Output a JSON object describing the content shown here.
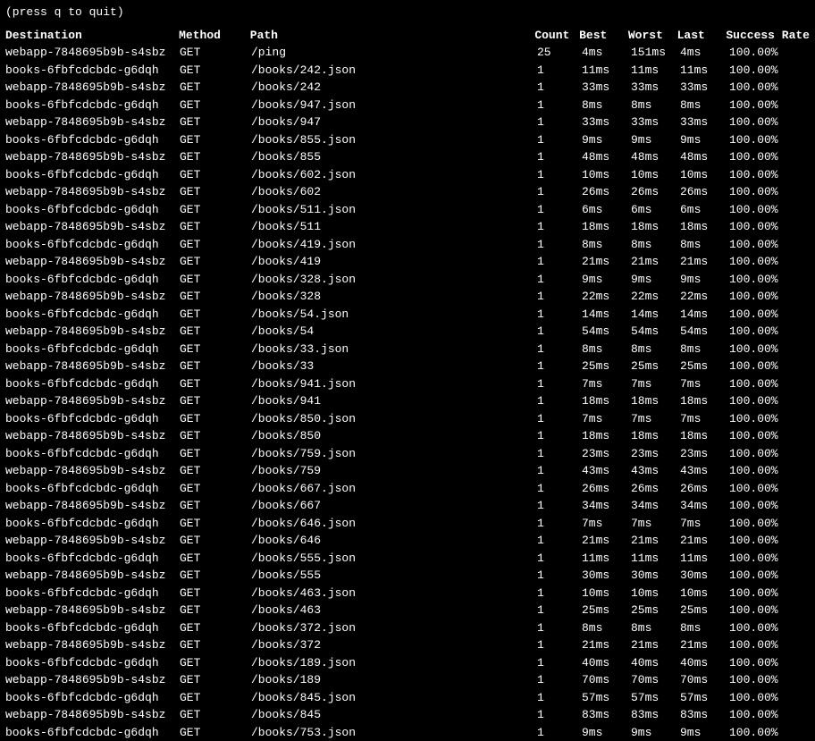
{
  "hint": "(press q to quit)",
  "columns": {
    "destination": "Destination",
    "method": "Method",
    "path": "Path",
    "count": "Count",
    "best": "Best",
    "worst": "Worst",
    "last": "Last",
    "success_rate": "Success Rate"
  },
  "rows": [
    {
      "destination": "webapp-7848695b9b-s4sbz",
      "method": "GET",
      "path": "/ping",
      "count": "25",
      "best": "4ms",
      "worst": "151ms",
      "last": "4ms",
      "success_rate": "100.00%"
    },
    {
      "destination": "books-6fbfcdcbdc-g6dqh",
      "method": "GET",
      "path": "/books/242.json",
      "count": "1",
      "best": "11ms",
      "worst": "11ms",
      "last": "11ms",
      "success_rate": "100.00%"
    },
    {
      "destination": "webapp-7848695b9b-s4sbz",
      "method": "GET",
      "path": "/books/242",
      "count": "1",
      "best": "33ms",
      "worst": "33ms",
      "last": "33ms",
      "success_rate": "100.00%"
    },
    {
      "destination": "books-6fbfcdcbdc-g6dqh",
      "method": "GET",
      "path": "/books/947.json",
      "count": "1",
      "best": "8ms",
      "worst": "8ms",
      "last": "8ms",
      "success_rate": "100.00%"
    },
    {
      "destination": "webapp-7848695b9b-s4sbz",
      "method": "GET",
      "path": "/books/947",
      "count": "1",
      "best": "33ms",
      "worst": "33ms",
      "last": "33ms",
      "success_rate": "100.00%"
    },
    {
      "destination": "books-6fbfcdcbdc-g6dqh",
      "method": "GET",
      "path": "/books/855.json",
      "count": "1",
      "best": "9ms",
      "worst": "9ms",
      "last": "9ms",
      "success_rate": "100.00%"
    },
    {
      "destination": "webapp-7848695b9b-s4sbz",
      "method": "GET",
      "path": "/books/855",
      "count": "1",
      "best": "48ms",
      "worst": "48ms",
      "last": "48ms",
      "success_rate": "100.00%"
    },
    {
      "destination": "books-6fbfcdcbdc-g6dqh",
      "method": "GET",
      "path": "/books/602.json",
      "count": "1",
      "best": "10ms",
      "worst": "10ms",
      "last": "10ms",
      "success_rate": "100.00%"
    },
    {
      "destination": "webapp-7848695b9b-s4sbz",
      "method": "GET",
      "path": "/books/602",
      "count": "1",
      "best": "26ms",
      "worst": "26ms",
      "last": "26ms",
      "success_rate": "100.00%"
    },
    {
      "destination": "books-6fbfcdcbdc-g6dqh",
      "method": "GET",
      "path": "/books/511.json",
      "count": "1",
      "best": "6ms",
      "worst": "6ms",
      "last": "6ms",
      "success_rate": "100.00%"
    },
    {
      "destination": "webapp-7848695b9b-s4sbz",
      "method": "GET",
      "path": "/books/511",
      "count": "1",
      "best": "18ms",
      "worst": "18ms",
      "last": "18ms",
      "success_rate": "100.00%"
    },
    {
      "destination": "books-6fbfcdcbdc-g6dqh",
      "method": "GET",
      "path": "/books/419.json",
      "count": "1",
      "best": "8ms",
      "worst": "8ms",
      "last": "8ms",
      "success_rate": "100.00%"
    },
    {
      "destination": "webapp-7848695b9b-s4sbz",
      "method": "GET",
      "path": "/books/419",
      "count": "1",
      "best": "21ms",
      "worst": "21ms",
      "last": "21ms",
      "success_rate": "100.00%"
    },
    {
      "destination": "books-6fbfcdcbdc-g6dqh",
      "method": "GET",
      "path": "/books/328.json",
      "count": "1",
      "best": "9ms",
      "worst": "9ms",
      "last": "9ms",
      "success_rate": "100.00%"
    },
    {
      "destination": "webapp-7848695b9b-s4sbz",
      "method": "GET",
      "path": "/books/328",
      "count": "1",
      "best": "22ms",
      "worst": "22ms",
      "last": "22ms",
      "success_rate": "100.00%"
    },
    {
      "destination": "books-6fbfcdcbdc-g6dqh",
      "method": "GET",
      "path": "/books/54.json",
      "count": "1",
      "best": "14ms",
      "worst": "14ms",
      "last": "14ms",
      "success_rate": "100.00%"
    },
    {
      "destination": "webapp-7848695b9b-s4sbz",
      "method": "GET",
      "path": "/books/54",
      "count": "1",
      "best": "54ms",
      "worst": "54ms",
      "last": "54ms",
      "success_rate": "100.00%"
    },
    {
      "destination": "books-6fbfcdcbdc-g6dqh",
      "method": "GET",
      "path": "/books/33.json",
      "count": "1",
      "best": "8ms",
      "worst": "8ms",
      "last": "8ms",
      "success_rate": "100.00%"
    },
    {
      "destination": "webapp-7848695b9b-s4sbz",
      "method": "GET",
      "path": "/books/33",
      "count": "1",
      "best": "25ms",
      "worst": "25ms",
      "last": "25ms",
      "success_rate": "100.00%"
    },
    {
      "destination": "books-6fbfcdcbdc-g6dqh",
      "method": "GET",
      "path": "/books/941.json",
      "count": "1",
      "best": "7ms",
      "worst": "7ms",
      "last": "7ms",
      "success_rate": "100.00%"
    },
    {
      "destination": "webapp-7848695b9b-s4sbz",
      "method": "GET",
      "path": "/books/941",
      "count": "1",
      "best": "18ms",
      "worst": "18ms",
      "last": "18ms",
      "success_rate": "100.00%"
    },
    {
      "destination": "books-6fbfcdcbdc-g6dqh",
      "method": "GET",
      "path": "/books/850.json",
      "count": "1",
      "best": "7ms",
      "worst": "7ms",
      "last": "7ms",
      "success_rate": "100.00%"
    },
    {
      "destination": "webapp-7848695b9b-s4sbz",
      "method": "GET",
      "path": "/books/850",
      "count": "1",
      "best": "18ms",
      "worst": "18ms",
      "last": "18ms",
      "success_rate": "100.00%"
    },
    {
      "destination": "books-6fbfcdcbdc-g6dqh",
      "method": "GET",
      "path": "/books/759.json",
      "count": "1",
      "best": "23ms",
      "worst": "23ms",
      "last": "23ms",
      "success_rate": "100.00%"
    },
    {
      "destination": "webapp-7848695b9b-s4sbz",
      "method": "GET",
      "path": "/books/759",
      "count": "1",
      "best": "43ms",
      "worst": "43ms",
      "last": "43ms",
      "success_rate": "100.00%"
    },
    {
      "destination": "books-6fbfcdcbdc-g6dqh",
      "method": "GET",
      "path": "/books/667.json",
      "count": "1",
      "best": "26ms",
      "worst": "26ms",
      "last": "26ms",
      "success_rate": "100.00%"
    },
    {
      "destination": "webapp-7848695b9b-s4sbz",
      "method": "GET",
      "path": "/books/667",
      "count": "1",
      "best": "34ms",
      "worst": "34ms",
      "last": "34ms",
      "success_rate": "100.00%"
    },
    {
      "destination": "books-6fbfcdcbdc-g6dqh",
      "method": "GET",
      "path": "/books/646.json",
      "count": "1",
      "best": "7ms",
      "worst": "7ms",
      "last": "7ms",
      "success_rate": "100.00%"
    },
    {
      "destination": "webapp-7848695b9b-s4sbz",
      "method": "GET",
      "path": "/books/646",
      "count": "1",
      "best": "21ms",
      "worst": "21ms",
      "last": "21ms",
      "success_rate": "100.00%"
    },
    {
      "destination": "books-6fbfcdcbdc-g6dqh",
      "method": "GET",
      "path": "/books/555.json",
      "count": "1",
      "best": "11ms",
      "worst": "11ms",
      "last": "11ms",
      "success_rate": "100.00%"
    },
    {
      "destination": "webapp-7848695b9b-s4sbz",
      "method": "GET",
      "path": "/books/555",
      "count": "1",
      "best": "30ms",
      "worst": "30ms",
      "last": "30ms",
      "success_rate": "100.00%"
    },
    {
      "destination": "books-6fbfcdcbdc-g6dqh",
      "method": "GET",
      "path": "/books/463.json",
      "count": "1",
      "best": "10ms",
      "worst": "10ms",
      "last": "10ms",
      "success_rate": "100.00%"
    },
    {
      "destination": "webapp-7848695b9b-s4sbz",
      "method": "GET",
      "path": "/books/463",
      "count": "1",
      "best": "25ms",
      "worst": "25ms",
      "last": "25ms",
      "success_rate": "100.00%"
    },
    {
      "destination": "books-6fbfcdcbdc-g6dqh",
      "method": "GET",
      "path": "/books/372.json",
      "count": "1",
      "best": "8ms",
      "worst": "8ms",
      "last": "8ms",
      "success_rate": "100.00%"
    },
    {
      "destination": "webapp-7848695b9b-s4sbz",
      "method": "GET",
      "path": "/books/372",
      "count": "1",
      "best": "21ms",
      "worst": "21ms",
      "last": "21ms",
      "success_rate": "100.00%"
    },
    {
      "destination": "books-6fbfcdcbdc-g6dqh",
      "method": "GET",
      "path": "/books/189.json",
      "count": "1",
      "best": "40ms",
      "worst": "40ms",
      "last": "40ms",
      "success_rate": "100.00%"
    },
    {
      "destination": "webapp-7848695b9b-s4sbz",
      "method": "GET",
      "path": "/books/189",
      "count": "1",
      "best": "70ms",
      "worst": "70ms",
      "last": "70ms",
      "success_rate": "100.00%"
    },
    {
      "destination": "books-6fbfcdcbdc-g6dqh",
      "method": "GET",
      "path": "/books/845.json",
      "count": "1",
      "best": "57ms",
      "worst": "57ms",
      "last": "57ms",
      "success_rate": "100.00%"
    },
    {
      "destination": "webapp-7848695b9b-s4sbz",
      "method": "GET",
      "path": "/books/845",
      "count": "1",
      "best": "83ms",
      "worst": "83ms",
      "last": "83ms",
      "success_rate": "100.00%"
    },
    {
      "destination": "books-6fbfcdcbdc-g6dqh",
      "method": "GET",
      "path": "/books/753.json",
      "count": "1",
      "best": "9ms",
      "worst": "9ms",
      "last": "9ms",
      "success_rate": "100.00%"
    }
  ]
}
